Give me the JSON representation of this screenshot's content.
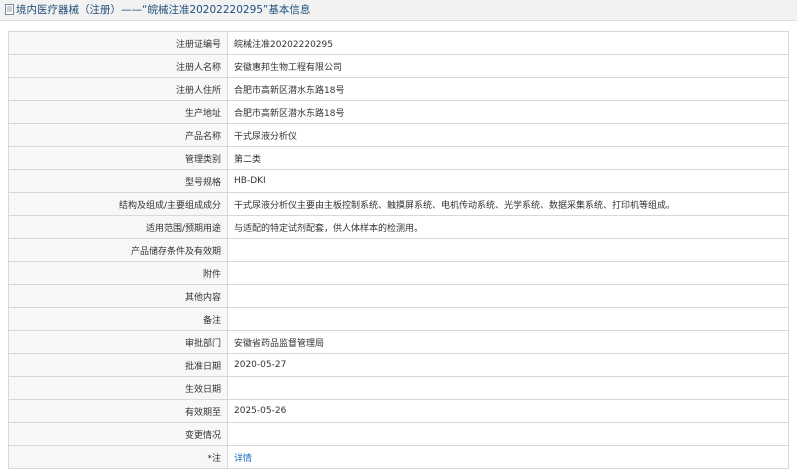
{
  "header": {
    "title": "境内医疗器械（注册）——“皖械注准20202220295”基本信息"
  },
  "rows": [
    {
      "label": "注册证编号",
      "value": "皖械注准20202220295"
    },
    {
      "label": "注册人名称",
      "value": "安徽惠邦生物工程有限公司"
    },
    {
      "label": "注册人住所",
      "value": "合肥市高新区潜水东路18号"
    },
    {
      "label": "生产地址",
      "value": "合肥市高新区潜水东路18号"
    },
    {
      "label": "产品名称",
      "value": "干式尿液分析仪"
    },
    {
      "label": "管理类别",
      "value": "第二类"
    },
    {
      "label": "型号规格",
      "value": "HB-DKI"
    },
    {
      "label": "结构及组成/主要组成成分",
      "value": "干式尿液分析仪主要由主板控制系统、触摸屏系统、电机传动系统、光学系统、数据采集系统、打印机等组成。"
    },
    {
      "label": "适用范围/预期用途",
      "value": "与适配的特定试剂配套，供人体样本的检测用。"
    },
    {
      "label": "产品储存条件及有效期",
      "value": ""
    },
    {
      "label": "附件",
      "value": ""
    },
    {
      "label": "其他内容",
      "value": ""
    },
    {
      "label": "备注",
      "value": ""
    },
    {
      "label": "审批部门",
      "value": "安徽省药品监督管理局"
    },
    {
      "label": "批准日期",
      "value": "2020-05-27"
    },
    {
      "label": "生效日期",
      "value": ""
    },
    {
      "label": "有效期至",
      "value": "2025-05-26"
    },
    {
      "label": "变更情况",
      "value": ""
    }
  ],
  "note_row": {
    "label": "*注",
    "link_text": "详情"
  },
  "colors": {
    "title_text": "#1f4e79",
    "link": "#1a6ec2",
    "border": "#d8d8d8"
  }
}
